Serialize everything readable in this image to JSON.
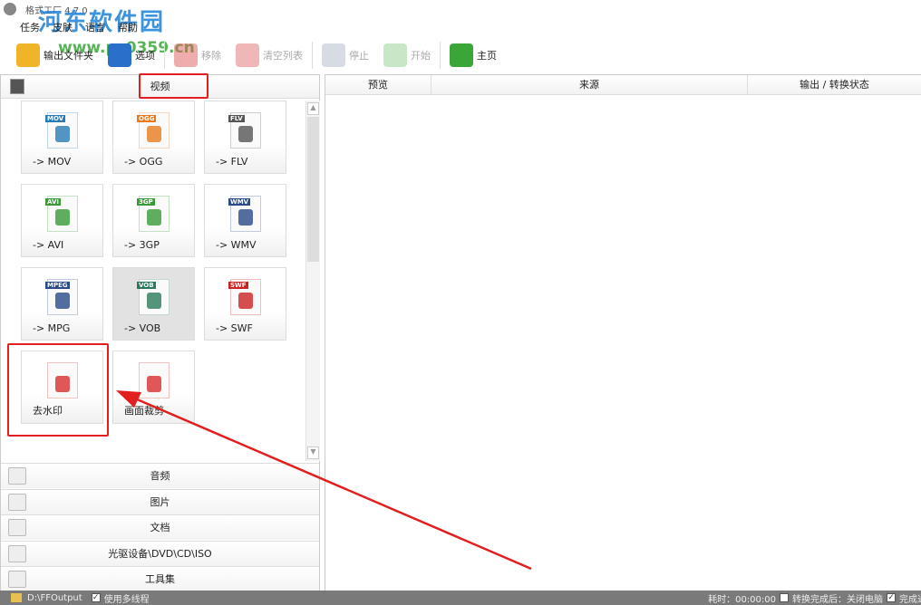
{
  "app": {
    "title": "格式工厂 4.7.0"
  },
  "watermark": {
    "name": "河东软件园",
    "url": "www.pc0359.cn"
  },
  "menu": [
    "任务",
    "皮肤",
    "语言",
    "帮助"
  ],
  "toolbar": [
    {
      "label": "输出文件夹",
      "disabled": false,
      "icon": "folder-icon",
      "color": "#f0b429"
    },
    {
      "label": "选项",
      "disabled": false,
      "icon": "gear-icon",
      "color": "#2a6fc9"
    },
    {
      "label": "移除",
      "disabled": true,
      "icon": "minus-icon",
      "color": "#e05a5a"
    },
    {
      "label": "清空列表",
      "disabled": true,
      "icon": "clear-icon",
      "color": "#e07070"
    },
    {
      "label": "停止",
      "disabled": true,
      "icon": "stop-icon",
      "color": "#b0b8c8"
    },
    {
      "label": "开始",
      "disabled": true,
      "icon": "start-icon",
      "color": "#8fcf8f"
    },
    {
      "label": "主页",
      "disabled": false,
      "icon": "home-globe-icon",
      "color": "#3aa63a"
    }
  ],
  "video_section": {
    "label": "视频"
  },
  "tiles": [
    {
      "label": "-> MOV",
      "badge": "MOV",
      "color": "#2a7ab8"
    },
    {
      "label": "-> OGG",
      "badge": "OGG",
      "color": "#e87a1d"
    },
    {
      "label": "-> FLV",
      "badge": "FLV",
      "color": "#555555"
    },
    {
      "label": "-> AVI",
      "badge": "AVI",
      "color": "#3a9a3a"
    },
    {
      "label": "-> 3GP",
      "badge": "3GP",
      "color": "#3a9a3a"
    },
    {
      "label": "-> WMV",
      "badge": "WMV",
      "color": "#2a4a8a"
    },
    {
      "label": "-> MPG",
      "badge": "MPEG",
      "color": "#2a4a8a"
    },
    {
      "label": "-> VOB",
      "badge": "VOB",
      "color": "#2a7a5a",
      "selected": true
    },
    {
      "label": "-> SWF",
      "badge": "SWF",
      "color": "#cc2222"
    },
    {
      "label": "去水印",
      "badge": "",
      "color": "#d83030"
    },
    {
      "label": "画面裁剪",
      "badge": "",
      "color": "#d83030"
    }
  ],
  "categories": [
    {
      "label": "音频",
      "icon": "music-icon"
    },
    {
      "label": "图片",
      "icon": "picture-icon"
    },
    {
      "label": "文档",
      "icon": "document-icon"
    },
    {
      "label": "光驱设备\\DVD\\CD\\ISO",
      "icon": "disc-drive-icon"
    },
    {
      "label": "工具集",
      "icon": "tools-icon"
    }
  ],
  "task_list": {
    "columns": [
      "预览",
      "来源",
      "输出 / 转换状态"
    ]
  },
  "status": {
    "output_folder": "D:\\FFOutput",
    "multithread": "使用多线程",
    "elapsed": "耗时：00:00:00",
    "after_done": "转换完成后：关闭电脑",
    "notify": "完成通知"
  }
}
